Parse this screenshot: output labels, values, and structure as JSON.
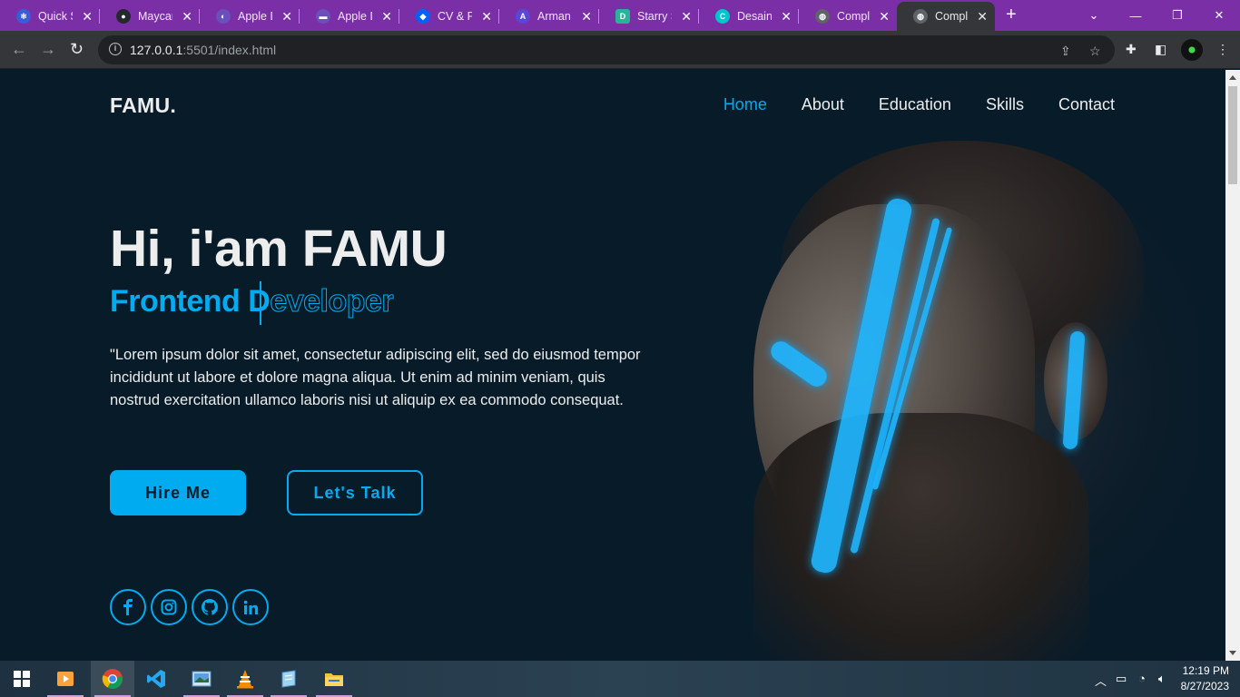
{
  "browser": {
    "tabs": [
      {
        "title": "Quick Start",
        "color": "#3b5bdb"
      },
      {
        "title": "Maycana",
        "color": "#24292f"
      },
      {
        "title": "Apple Design",
        "color": "#6b4fbb"
      },
      {
        "title": "Apple Design",
        "color": "#6b4fbb"
      },
      {
        "title": "CV & Portfolio",
        "color": "#0061fe"
      },
      {
        "title": "Arman P",
        "color": "#5b46d8"
      },
      {
        "title": "Starry Sky",
        "color": "#2bb39a"
      },
      {
        "title": "Desain t",
        "color": "#00c4cc"
      },
      {
        "title": "Complete",
        "color": "#5f6368"
      },
      {
        "title": "Complete",
        "color": "#5f6368"
      }
    ],
    "url_host": "127.0.0.1",
    "url_path": ":5501/index.html"
  },
  "site": {
    "logo": "FAMU.",
    "nav": [
      "Home",
      "About",
      "Education",
      "Skills",
      "Contact"
    ],
    "greeting": "Hi, i'am FAMU",
    "role_solid": "Frontend D",
    "role_outline": "eveloper",
    "description": "\"Lorem ipsum dolor sit amet, consectetur adipiscing elit, sed do eiusmod tempor incididunt ut labore et dolore magna aliqua. Ut enim ad minim veniam, quis nostrud exercitation ullamco laboris nisi ut aliquip ex ea commodo consequat.",
    "btn_hire": "Hire Me",
    "btn_talk": "Let's Talk",
    "social": [
      "facebook-icon",
      "instagram-icon",
      "github-icon",
      "linkedin-icon"
    ],
    "accent": "#00abf0",
    "background": "#081b29"
  },
  "taskbar": {
    "time": "12:19 PM",
    "date": "8/27/2023"
  }
}
